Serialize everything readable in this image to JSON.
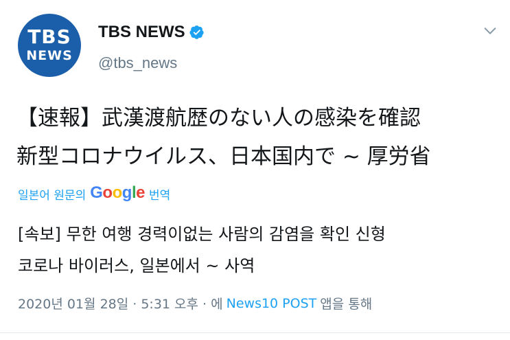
{
  "account": {
    "avatar_line1": "TBS",
    "avatar_line2": "NEWS",
    "display_name": "TBS NEWS",
    "verified_icon": "verified-badge-icon",
    "handle": "@tbs_news"
  },
  "tweet": {
    "text": "【速報】武漢渡航歴のない人の感染を確認\n新型コロナウイルス、日本国内で ~ 厚労省"
  },
  "translation": {
    "prefix": "일본어 원문의",
    "google_letters": [
      "G",
      "o",
      "o",
      "g",
      "l",
      "e"
    ],
    "google_colors": [
      "#4285f4",
      "#ea4335",
      "#fbbc05",
      "#4285f4",
      "#34a853",
      "#ea4335"
    ],
    "suffix": "번역",
    "text": "[속보] 무한 여행 경력이없는 사람의 감염을 확인 신형\n코로나 바이러스, 일본에서 ~ 사역"
  },
  "meta": {
    "timestamp": "2020년 01월 28일 · 5:31 오후 · 에",
    "source": "News10 POST",
    "suffix": "앱을 통해"
  },
  "colors": {
    "link": "#1da1f2",
    "muted": "#657786",
    "avatar_bg": "#1b5ea9"
  }
}
